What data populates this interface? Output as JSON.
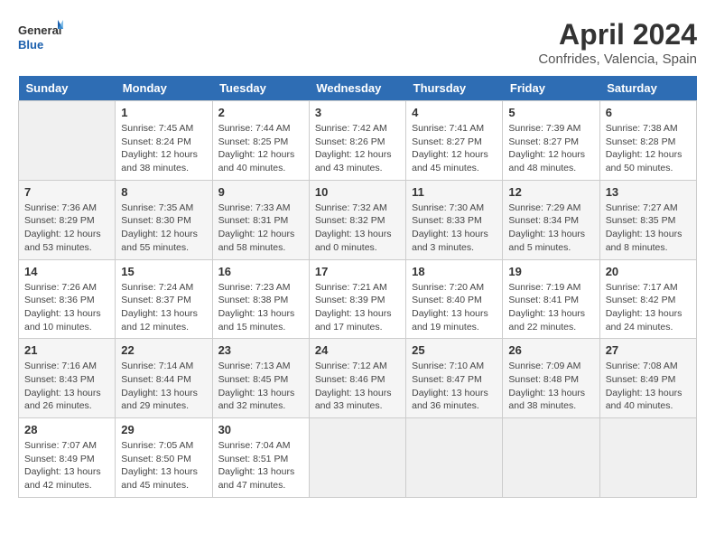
{
  "header": {
    "logo_line1": "General",
    "logo_line2": "Blue",
    "month": "April 2024",
    "location": "Confrides, Valencia, Spain"
  },
  "days_of_week": [
    "Sunday",
    "Monday",
    "Tuesday",
    "Wednesday",
    "Thursday",
    "Friday",
    "Saturday"
  ],
  "weeks": [
    [
      {
        "day": "",
        "info": ""
      },
      {
        "day": "1",
        "info": "Sunrise: 7:45 AM\nSunset: 8:24 PM\nDaylight: 12 hours\nand 38 minutes."
      },
      {
        "day": "2",
        "info": "Sunrise: 7:44 AM\nSunset: 8:25 PM\nDaylight: 12 hours\nand 40 minutes."
      },
      {
        "day": "3",
        "info": "Sunrise: 7:42 AM\nSunset: 8:26 PM\nDaylight: 12 hours\nand 43 minutes."
      },
      {
        "day": "4",
        "info": "Sunrise: 7:41 AM\nSunset: 8:27 PM\nDaylight: 12 hours\nand 45 minutes."
      },
      {
        "day": "5",
        "info": "Sunrise: 7:39 AM\nSunset: 8:27 PM\nDaylight: 12 hours\nand 48 minutes."
      },
      {
        "day": "6",
        "info": "Sunrise: 7:38 AM\nSunset: 8:28 PM\nDaylight: 12 hours\nand 50 minutes."
      }
    ],
    [
      {
        "day": "7",
        "info": "Sunrise: 7:36 AM\nSunset: 8:29 PM\nDaylight: 12 hours\nand 53 minutes."
      },
      {
        "day": "8",
        "info": "Sunrise: 7:35 AM\nSunset: 8:30 PM\nDaylight: 12 hours\nand 55 minutes."
      },
      {
        "day": "9",
        "info": "Sunrise: 7:33 AM\nSunset: 8:31 PM\nDaylight: 12 hours\nand 58 minutes."
      },
      {
        "day": "10",
        "info": "Sunrise: 7:32 AM\nSunset: 8:32 PM\nDaylight: 13 hours\nand 0 minutes."
      },
      {
        "day": "11",
        "info": "Sunrise: 7:30 AM\nSunset: 8:33 PM\nDaylight: 13 hours\nand 3 minutes."
      },
      {
        "day": "12",
        "info": "Sunrise: 7:29 AM\nSunset: 8:34 PM\nDaylight: 13 hours\nand 5 minutes."
      },
      {
        "day": "13",
        "info": "Sunrise: 7:27 AM\nSunset: 8:35 PM\nDaylight: 13 hours\nand 8 minutes."
      }
    ],
    [
      {
        "day": "14",
        "info": "Sunrise: 7:26 AM\nSunset: 8:36 PM\nDaylight: 13 hours\nand 10 minutes."
      },
      {
        "day": "15",
        "info": "Sunrise: 7:24 AM\nSunset: 8:37 PM\nDaylight: 13 hours\nand 12 minutes."
      },
      {
        "day": "16",
        "info": "Sunrise: 7:23 AM\nSunset: 8:38 PM\nDaylight: 13 hours\nand 15 minutes."
      },
      {
        "day": "17",
        "info": "Sunrise: 7:21 AM\nSunset: 8:39 PM\nDaylight: 13 hours\nand 17 minutes."
      },
      {
        "day": "18",
        "info": "Sunrise: 7:20 AM\nSunset: 8:40 PM\nDaylight: 13 hours\nand 19 minutes."
      },
      {
        "day": "19",
        "info": "Sunrise: 7:19 AM\nSunset: 8:41 PM\nDaylight: 13 hours\nand 22 minutes."
      },
      {
        "day": "20",
        "info": "Sunrise: 7:17 AM\nSunset: 8:42 PM\nDaylight: 13 hours\nand 24 minutes."
      }
    ],
    [
      {
        "day": "21",
        "info": "Sunrise: 7:16 AM\nSunset: 8:43 PM\nDaylight: 13 hours\nand 26 minutes."
      },
      {
        "day": "22",
        "info": "Sunrise: 7:14 AM\nSunset: 8:44 PM\nDaylight: 13 hours\nand 29 minutes."
      },
      {
        "day": "23",
        "info": "Sunrise: 7:13 AM\nSunset: 8:45 PM\nDaylight: 13 hours\nand 32 minutes."
      },
      {
        "day": "24",
        "info": "Sunrise: 7:12 AM\nSunset: 8:46 PM\nDaylight: 13 hours\nand 33 minutes."
      },
      {
        "day": "25",
        "info": "Sunrise: 7:10 AM\nSunset: 8:47 PM\nDaylight: 13 hours\nand 36 minutes."
      },
      {
        "day": "26",
        "info": "Sunrise: 7:09 AM\nSunset: 8:48 PM\nDaylight: 13 hours\nand 38 minutes."
      },
      {
        "day": "27",
        "info": "Sunrise: 7:08 AM\nSunset: 8:49 PM\nDaylight: 13 hours\nand 40 minutes."
      }
    ],
    [
      {
        "day": "28",
        "info": "Sunrise: 7:07 AM\nSunset: 8:49 PM\nDaylight: 13 hours\nand 42 minutes."
      },
      {
        "day": "29",
        "info": "Sunrise: 7:05 AM\nSunset: 8:50 PM\nDaylight: 13 hours\nand 45 minutes."
      },
      {
        "day": "30",
        "info": "Sunrise: 7:04 AM\nSunset: 8:51 PM\nDaylight: 13 hours\nand 47 minutes."
      },
      {
        "day": "",
        "info": ""
      },
      {
        "day": "",
        "info": ""
      },
      {
        "day": "",
        "info": ""
      },
      {
        "day": "",
        "info": ""
      }
    ]
  ]
}
